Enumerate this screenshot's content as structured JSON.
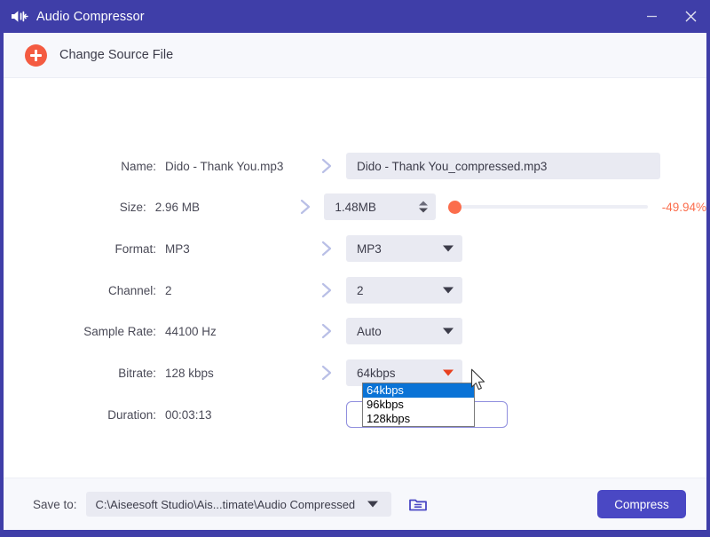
{
  "window": {
    "title": "Audio Compressor",
    "app_icon": "speaker-icon",
    "minimize_label": "—",
    "close_label": "✕",
    "titlebar_color": "#3f3ea8"
  },
  "toolbar": {
    "change_source_label": "Change Source File",
    "plus_icon_color": "#f45b41"
  },
  "form": {
    "rows": [
      {
        "label": "Name:",
        "value": "Dido - Thank You.mp3",
        "output": "Dido - Thank You_compressed.mp3"
      },
      {
        "label": "Size:",
        "value": "2.96 MB",
        "output": "1.48MB",
        "percent": "-49.94%"
      },
      {
        "label": "Format:",
        "value": "MP3",
        "output": "MP3"
      },
      {
        "label": "Channel:",
        "value": "2",
        "output": "2"
      },
      {
        "label": "Sample Rate:",
        "value": "44100 Hz",
        "output": "Auto"
      },
      {
        "label": "Bitrate:",
        "value": "128 kbps",
        "output": "64kbps"
      },
      {
        "label": "Duration:",
        "value": "00:03:13",
        "output": ""
      }
    ],
    "slider": {
      "percent_label": "-49.94%",
      "percent_color": "#fb6d4c",
      "position": 0
    }
  },
  "bitrate_dropdown": {
    "open": true,
    "selected": "64kbps",
    "options": [
      "64kbps",
      "96kbps",
      "128kbps"
    ],
    "highlight_color": "#0a73d6"
  },
  "bottom": {
    "save_to_label": "Save to:",
    "path": "C:\\Aiseesoft Studio\\Ais...timate\\Audio Compressed",
    "folder_icon": "folder-icon",
    "compress_label": "Compress",
    "compress_color": "#4a48c4"
  }
}
